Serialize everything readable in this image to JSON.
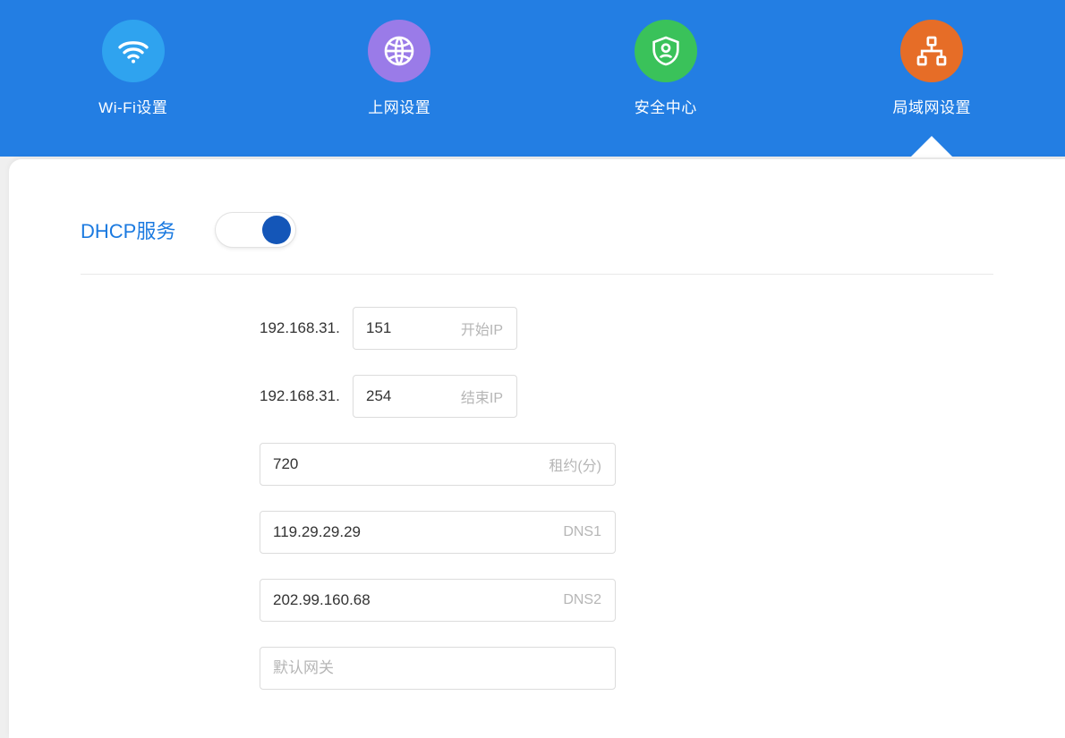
{
  "nav": [
    {
      "label": "Wi-Fi设置",
      "icon": "wifi",
      "color": "#2fa3ef"
    },
    {
      "label": "上网设置",
      "icon": "globe",
      "color": "#9a7be8"
    },
    {
      "label": "安全中心",
      "icon": "shield",
      "color": "#3ac25a"
    },
    {
      "label": "局域网设置",
      "icon": "lan",
      "color": "#e66d27"
    }
  ],
  "active_tab_index": 3,
  "dhcp": {
    "title": "DHCP服务",
    "enabled": true,
    "ip_prefix": "192.168.31.",
    "start_ip": "151",
    "start_ip_label": "开始IP",
    "end_ip": "254",
    "end_ip_label": "结束IP",
    "lease": "720",
    "lease_label": "租约(分)",
    "dns1": "119.29.29.29",
    "dns1_label": "DNS1",
    "dns2": "202.99.160.68",
    "dns2_label": "DNS2",
    "gateway": "",
    "gateway_placeholder": "默认网关"
  }
}
